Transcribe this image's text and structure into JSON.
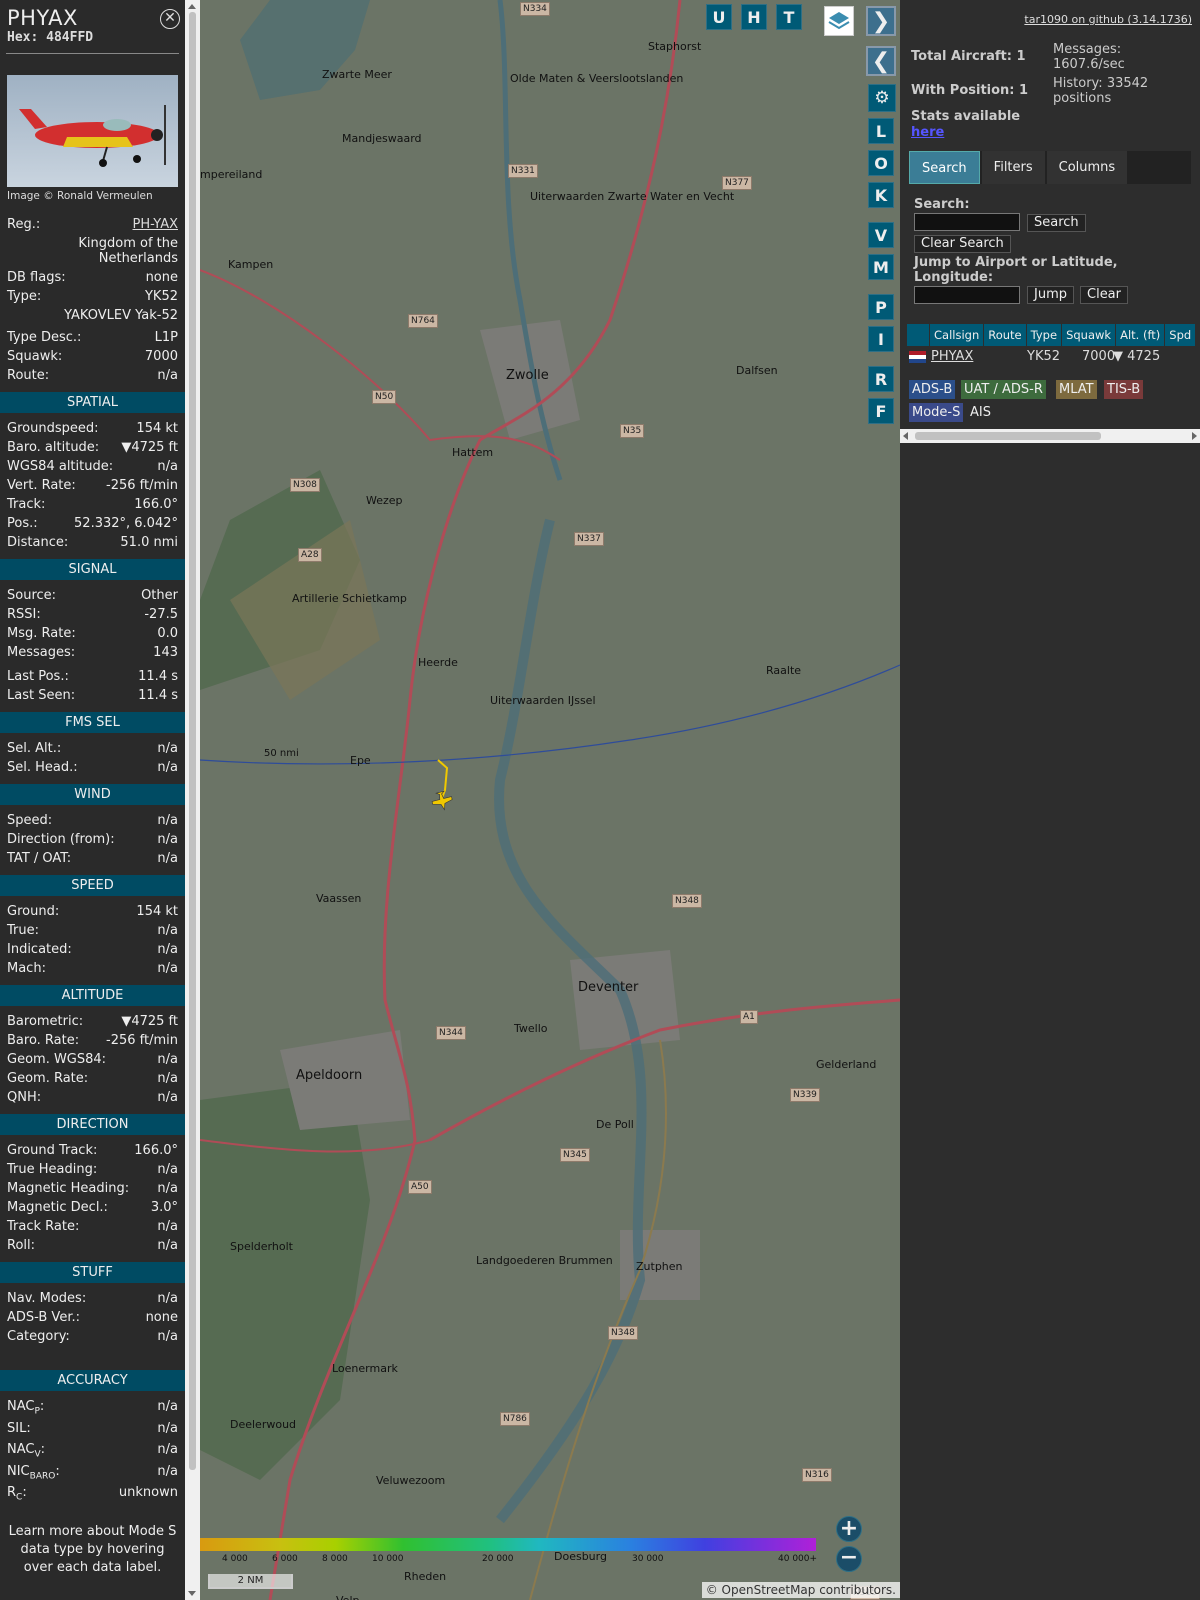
{
  "aircraft": {
    "callsign": "PHYAX",
    "hex": "Hex: 484FFD",
    "close_icon": "close-icon",
    "image_credit": "Image © Ronald Vermeulen",
    "reg_label": "Reg.:",
    "reg_value": "PH-YAX",
    "country": "Kingdom of the Netherlands",
    "db_flags_label": "DB flags:",
    "db_flags_value": "none",
    "type_label": "Type:",
    "type_value": "YK52",
    "type_name": "YAKOVLEV Yak-52",
    "type_desc_label": "Type Desc.:",
    "type_desc_value": "L1P",
    "squawk_label": "Squawk:",
    "squawk_value": "7000",
    "route_label": "Route:",
    "route_value": "n/a"
  },
  "sections": {
    "spatial": {
      "title": "SPATIAL",
      "rows": [
        {
          "k": "Groundspeed:",
          "v": "154 kt"
        },
        {
          "k": "Baro. altitude:",
          "v": "▼4725 ft"
        },
        {
          "k": "WGS84 altitude:",
          "v": "n/a"
        },
        {
          "k": "Vert. Rate:",
          "v": "-256 ft/min"
        },
        {
          "k": "Track:",
          "v": "166.0°"
        },
        {
          "k": "Pos.:",
          "v": "52.332°, 6.042°"
        },
        {
          "k": "Distance:",
          "v": "51.0 nmi"
        }
      ]
    },
    "signal": {
      "title": "SIGNAL",
      "rows": [
        {
          "k": "Source:",
          "v": "Other"
        },
        {
          "k": "RSSI:",
          "v": "-27.5"
        },
        {
          "k": "Msg. Rate:",
          "v": "0.0"
        },
        {
          "k": "Messages:",
          "v": "143"
        },
        {
          "k": "Last Pos.:",
          "v": "11.4 s"
        },
        {
          "k": "Last Seen:",
          "v": "11.4 s"
        }
      ]
    },
    "fms": {
      "title": "FMS SEL",
      "rows": [
        {
          "k": "Sel. Alt.:",
          "v": "n/a"
        },
        {
          "k": "Sel. Head.:",
          "v": "n/a"
        }
      ]
    },
    "wind": {
      "title": "WIND",
      "rows": [
        {
          "k": "Speed:",
          "v": "n/a"
        },
        {
          "k": "Direction (from):",
          "v": "n/a"
        },
        {
          "k": "TAT / OAT:",
          "v": "n/a"
        }
      ]
    },
    "speed": {
      "title": "SPEED",
      "rows": [
        {
          "k": "Ground:",
          "v": "154 kt"
        },
        {
          "k": "True:",
          "v": "n/a"
        },
        {
          "k": "Indicated:",
          "v": "n/a"
        },
        {
          "k": "Mach:",
          "v": "n/a"
        }
      ]
    },
    "altitude": {
      "title": "ALTITUDE",
      "rows": [
        {
          "k": "Barometric:",
          "v": "▼4725 ft"
        },
        {
          "k": "Baro. Rate:",
          "v": "-256 ft/min"
        },
        {
          "k": "Geom. WGS84:",
          "v": "n/a"
        },
        {
          "k": "Geom. Rate:",
          "v": "n/a"
        },
        {
          "k": "QNH:",
          "v": "n/a"
        }
      ]
    },
    "direction": {
      "title": "DIRECTION",
      "rows": [
        {
          "k": "Ground Track:",
          "v": "166.0°"
        },
        {
          "k": "True Heading:",
          "v": "n/a"
        },
        {
          "k": "Magnetic Heading:",
          "v": "n/a"
        },
        {
          "k": "Magnetic Decl.:",
          "v": "3.0°"
        },
        {
          "k": "Track Rate:",
          "v": "n/a"
        },
        {
          "k": "Roll:",
          "v": "n/a"
        }
      ]
    },
    "stuff": {
      "title": "STUFF",
      "rows": [
        {
          "k": "Nav. Modes:",
          "v": "n/a"
        },
        {
          "k": "ADS-B Ver.:",
          "v": "none"
        },
        {
          "k": "Category:",
          "v": "n/a"
        }
      ]
    },
    "accuracy": {
      "title": "ACCURACY",
      "rows": [
        {
          "k": "NAC",
          "sub": "P",
          "v": "n/a"
        },
        {
          "k": "SIL:",
          "sub": "",
          "v": "n/a"
        },
        {
          "k": "NAC",
          "sub": "V",
          "v": "n/a"
        },
        {
          "k": "NIC",
          "sub": "BARO",
          "v": "n/a"
        },
        {
          "k": "R",
          "sub": "C",
          "v": "unknown"
        }
      ]
    }
  },
  "learn_more": "Learn more about Mode S data type by hovering over each data label.",
  "map": {
    "buttons_top": [
      "U",
      "H",
      "T"
    ],
    "buttons_side": [
      "L",
      "O",
      "K",
      "V",
      "M",
      "P",
      "I",
      "R",
      "F"
    ],
    "range_ring_label": "50 nmi",
    "places": [
      "N334",
      "Staphorst",
      "Zwarte Meer",
      "Olde Maten & Veerslootslanden",
      "Mandjeswaard",
      "mpereiland",
      "N331",
      "N377",
      "Uiterwaarden Zwarte Water en Vecht",
      "Kampen",
      "N764",
      "Zwolle",
      "Dalfsen",
      "N50",
      "N35",
      "Hattem",
      "N308",
      "Wezep",
      "N337",
      "A28",
      "Artillerie Schietkamp",
      "Heerde",
      "Raalte",
      "Uiterwaarden IJssel",
      "Epe",
      "Vaassen",
      "N348",
      "Deventer",
      "N344",
      "Twello",
      "A1",
      "Apeldoorn",
      "N339",
      "De Poll",
      "N345",
      "A50",
      "Spelderholt",
      "Zutphen",
      "Landgoederen Brummen",
      "N348",
      "Loenermark",
      "Deelerwoud",
      "N786",
      "Veluwezoom",
      "N316",
      "Doesburg",
      "Rheden",
      "N315",
      "Gelderland",
      "Velp"
    ],
    "scale": "2 NM",
    "zoom_in": "+",
    "zoom_out": "−",
    "attribution": "© OpenStreetMap contributors.",
    "altitude_ticks": [
      "4 000",
      "6 000",
      "8 000",
      "10 000",
      "20 000",
      "30 000",
      "40 000+"
    ]
  },
  "panel": {
    "github_link": "tar1090 on github (3.14.1736)",
    "total_aircraft": "Total Aircraft: 1",
    "with_position": "With Position: 1",
    "messages": "Messages: 1607.6/sec",
    "history": "History: 33542 positions",
    "stats": "Stats available",
    "stats_link": "here",
    "tabs": [
      "Search",
      "Filters",
      "Columns"
    ],
    "search_label": "Search:",
    "search_button": "Search",
    "clear_search_button": "Clear Search",
    "jump_label": "Jump to Airport or Latitude, Longitude:",
    "jump_button": "Jump",
    "clear_button": "Clear",
    "columns": [
      "Callsign",
      "Route",
      "Type",
      "Squawk",
      "Alt. (ft)",
      "Spd"
    ],
    "row": {
      "callsign": "PHYAX",
      "type": "YK52",
      "squawk": "7000",
      "alt": "▼ 4725"
    },
    "badges": [
      "ADS-B",
      "UAT / ADS-R",
      "MLAT",
      "TIS-B",
      "Mode-S",
      "AIS"
    ],
    "badge_colors": [
      "#2b4f8a",
      "#3d6b3d",
      "#7d6a3e",
      "#7a3a3a",
      "#3a4a8a",
      "#2d2d2d"
    ]
  }
}
